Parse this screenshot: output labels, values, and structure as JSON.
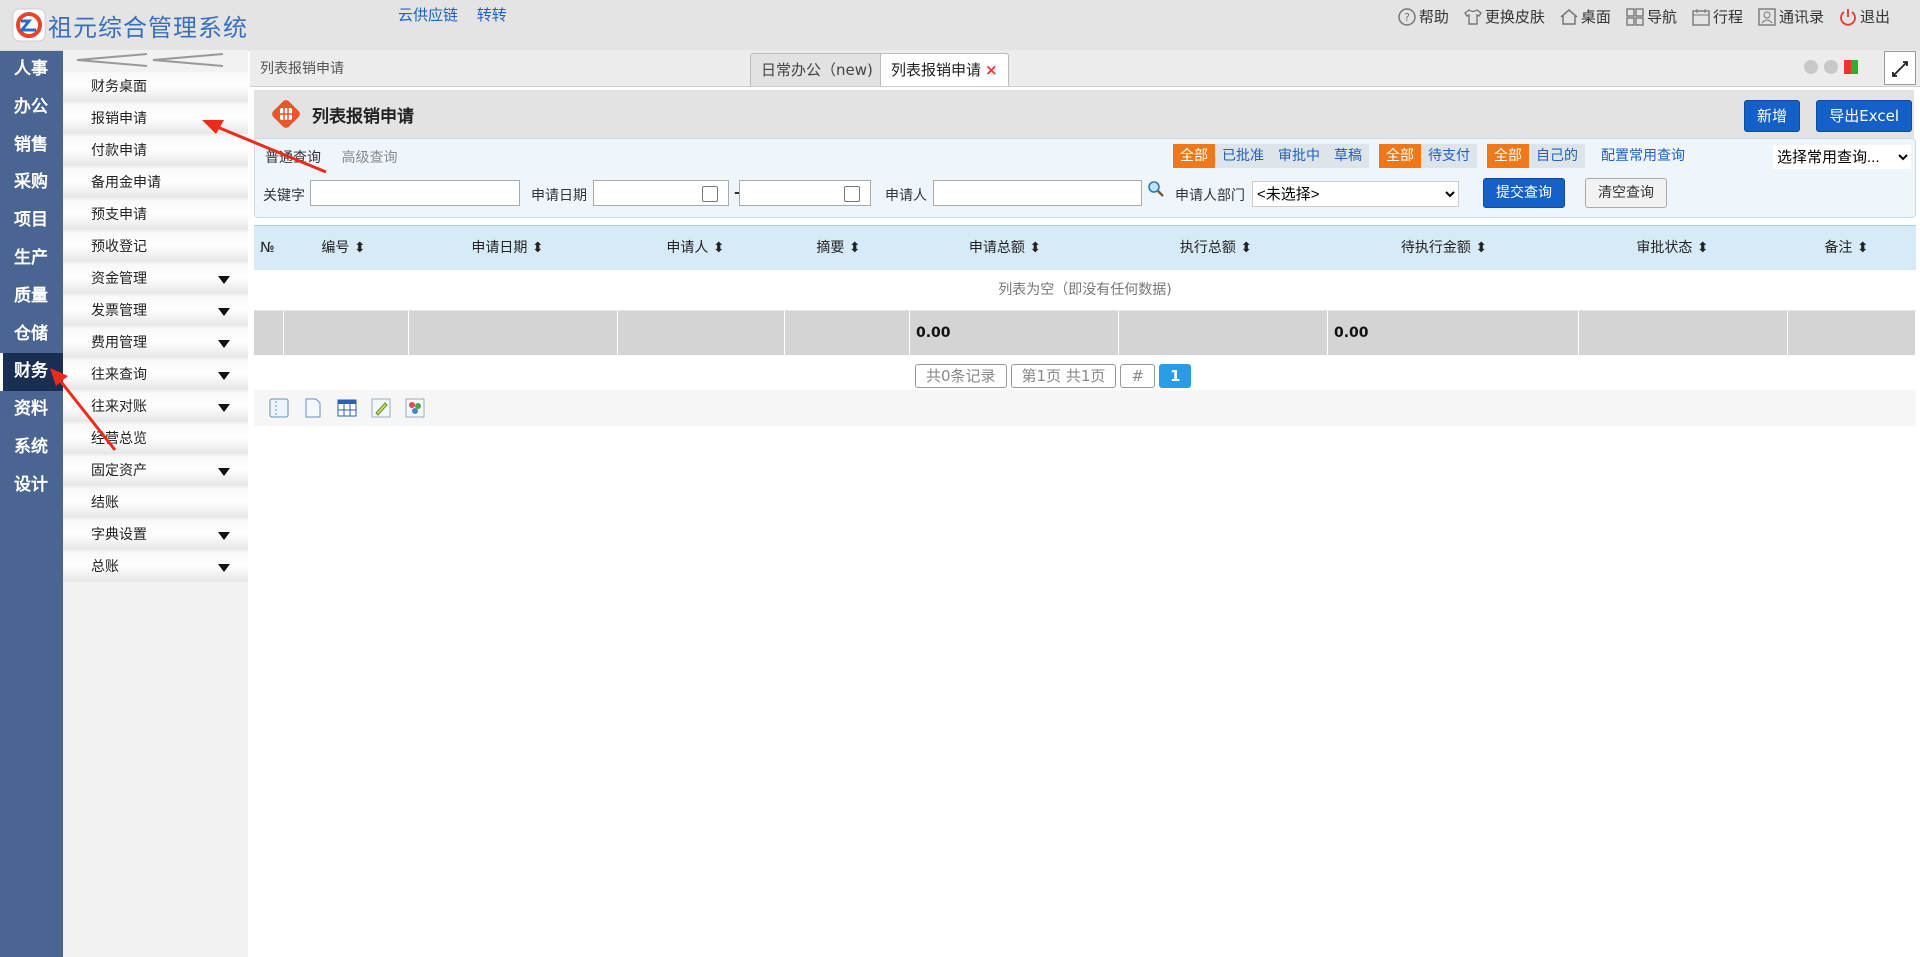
{
  "app": {
    "title": "祖元综合管理系统"
  },
  "top_links": [
    "云供应链",
    "转转"
  ],
  "top_right": [
    {
      "icon": "help-icon",
      "label": "帮助"
    },
    {
      "icon": "shirt-icon",
      "label": "更换皮肤"
    },
    {
      "icon": "home-icon",
      "label": "桌面"
    },
    {
      "icon": "grid-icon",
      "label": "导航"
    },
    {
      "icon": "calendar-icon",
      "label": "行程"
    },
    {
      "icon": "contacts-icon",
      "label": "通讯录"
    },
    {
      "icon": "power-icon",
      "label": "退出"
    }
  ],
  "leftnav": [
    "人事",
    "办公",
    "销售",
    "采购",
    "项目",
    "生产",
    "质量",
    "仓储",
    "财务",
    "资料",
    "系统",
    "设计"
  ],
  "leftnav_active": "财务",
  "submenu": [
    {
      "label": "财务桌面",
      "has_children": false
    },
    {
      "label": "报销申请",
      "has_children": false
    },
    {
      "label": "付款申请",
      "has_children": false
    },
    {
      "label": "备用金申请",
      "has_children": false
    },
    {
      "label": "预支申请",
      "has_children": false
    },
    {
      "label": "预收登记",
      "has_children": false
    },
    {
      "label": "资金管理",
      "has_children": true
    },
    {
      "label": "发票管理",
      "has_children": true
    },
    {
      "label": "费用管理",
      "has_children": true
    },
    {
      "label": "往来查询",
      "has_children": true
    },
    {
      "label": "往来对账",
      "has_children": true
    },
    {
      "label": "经营总览",
      "has_children": false
    },
    {
      "label": "固定资产",
      "has_children": true
    },
    {
      "label": "结账",
      "has_children": false
    },
    {
      "label": "字典设置",
      "has_children": true
    },
    {
      "label": "总账",
      "has_children": true
    }
  ],
  "breadcrumb": "列表报销申请",
  "tabs": [
    {
      "label": "日常办公（new)",
      "active": false
    },
    {
      "label": "列表报销申请",
      "active": true,
      "close": "×"
    }
  ],
  "page": {
    "title": "列表报销申请",
    "add_button": "新增",
    "export_button": "导出Excel"
  },
  "query": {
    "tab_normal": "普通查询",
    "tab_advanced": "高级查询",
    "filter_status": [
      "全部",
      "已批准",
      "审批中",
      "草稿"
    ],
    "filter_pay": [
      "全部",
      "待支付"
    ],
    "filter_owner": [
      "全部",
      "自己的"
    ],
    "config_link": "配置常用查询",
    "saved_query": "选择常用查询...",
    "keyword_label": "关键字",
    "date_label": "申请日期",
    "date_sep": "-",
    "applicant_label": "申请人",
    "dept_label": "申请人部门",
    "dept_value": "<未选择>",
    "submit": "提交查询",
    "clear": "清空查询"
  },
  "table": {
    "columns": [
      "№",
      "编号",
      "申请日期",
      "申请人",
      "摘要",
      "申请总额",
      "执行总额",
      "待执行金额",
      "审批状态",
      "备注"
    ],
    "empty_text": "列表为空（即没有任何数据)",
    "total_amount": "0.00",
    "total_pending": "0.00"
  },
  "pager": {
    "records": "共0条记录",
    "pages": "第1页 共1页",
    "hash": "#",
    "current": "1"
  },
  "toolbar_icons": [
    "column-settings-icon",
    "blank-page-icon",
    "table-icon",
    "edit-icon",
    "palette-icon"
  ],
  "colors": {
    "accent_orange": "#f07818",
    "primary_blue": "#1560c6",
    "nav_bg": "#4a6592",
    "nav_active": "#1a2d52",
    "grid_header": "#d7eaf8"
  }
}
